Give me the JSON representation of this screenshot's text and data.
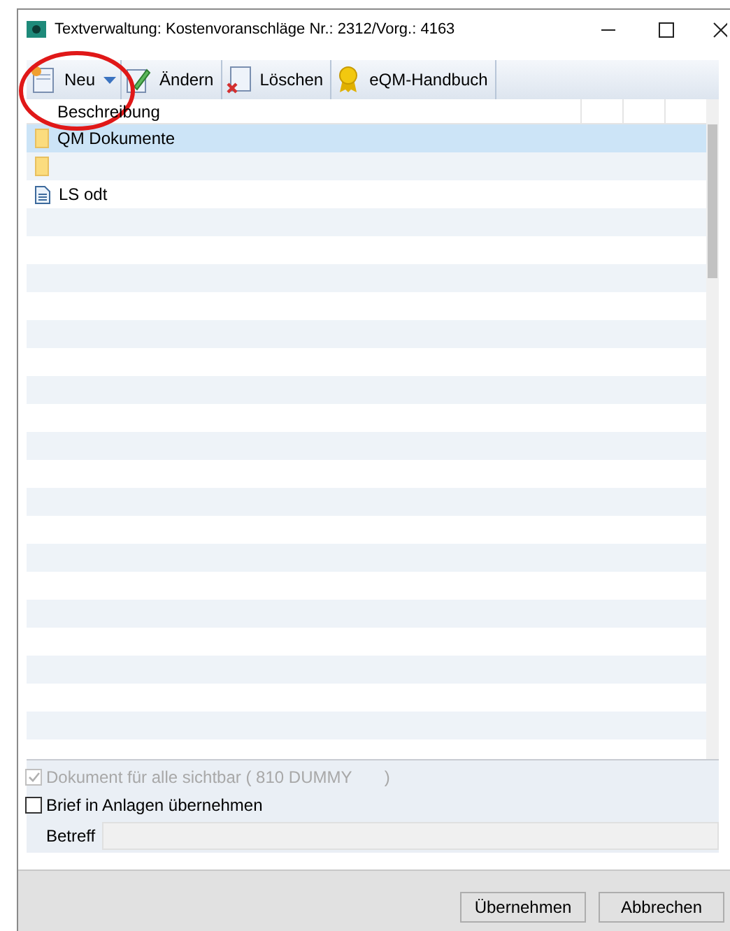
{
  "window": {
    "title": "Textverwaltung: Kostenvoranschläge Nr.: 2312/Vorg.: 4163"
  },
  "toolbar": [
    {
      "kind": "new",
      "label": "Neu"
    },
    {
      "kind": "edit",
      "label": "Ändern"
    },
    {
      "kind": "delete",
      "label": "Löschen"
    },
    {
      "kind": "handbook",
      "label": "eQM-Handbuch"
    }
  ],
  "table": {
    "columns": [
      "Beschreibung"
    ],
    "rows": [
      {
        "kind": "folder",
        "label": "QM Dokumente",
        "selected": true
      },
      {
        "kind": "folder",
        "selected": false
      },
      {
        "kind": "document",
        "label": "LS odt",
        "selected": false
      }
    ]
  },
  "options": [
    {
      "label": "Dokument für alle sichtbar ( 810 DUMMY       )",
      "checked": true,
      "disabled": true
    },
    {
      "label": "Brief in Anlagen übernehmen",
      "checked": false,
      "disabled": false
    }
  ],
  "subject": {
    "label": "Betreff"
  },
  "buttons": [
    "Übernehmen",
    "Abbrechen"
  ]
}
